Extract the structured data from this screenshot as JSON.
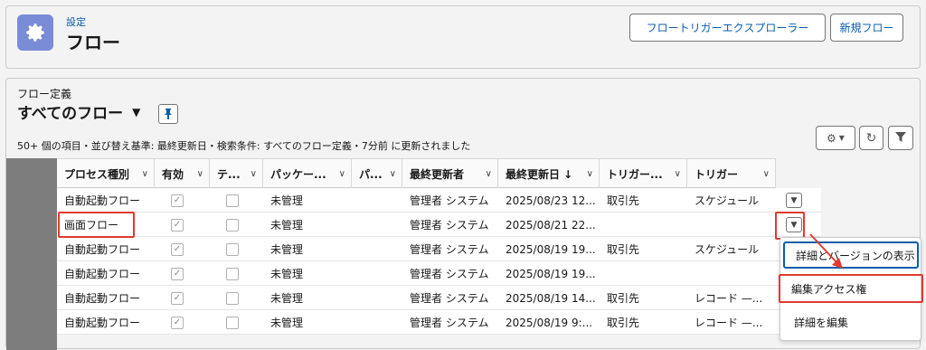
{
  "header": {
    "breadcrumb": "設定",
    "title": "フロー",
    "buttons": {
      "trigger_explorer": "フロートリガーエクスプローラー",
      "new_flow": "新規フロー"
    }
  },
  "list_view": {
    "object_label": "フロー定義",
    "view_name": "すべてのフロー",
    "status_text": "50+ 個の項目・並び替え基準: 最終更新日・検索条件: すべてのフロー定義・7分前 に更新されました"
  },
  "columns": [
    "プロセス種別",
    "有効",
    "テ...",
    "パッケー...",
    "パ...",
    "最終更新者",
    "最終更新日 ↓",
    "トリガー...",
    "トリガー"
  ],
  "rows": [
    {
      "process_type": "自動起動フロー",
      "active": true,
      "test": false,
      "package": "未管理",
      "p": "",
      "modified_by": "管理者 システム",
      "modified_date": "2025/08/23 12...",
      "trigger_object": "取引先",
      "trigger": "スケジュール"
    },
    {
      "process_type": "画面フロー",
      "active": true,
      "test": false,
      "package": "未管理",
      "p": "",
      "modified_by": "管理者 システム",
      "modified_date": "2025/08/21 22...",
      "trigger_object": "",
      "trigger": ""
    },
    {
      "process_type": "自動起動フロー",
      "active": true,
      "test": false,
      "package": "未管理",
      "p": "",
      "modified_by": "管理者 システム",
      "modified_date": "2025/08/19 19...",
      "trigger_object": "取引先",
      "trigger": "スケジュール"
    },
    {
      "process_type": "自動起動フロー",
      "active": true,
      "test": false,
      "package": "未管理",
      "p": "",
      "modified_by": "管理者 システム",
      "modified_date": "2025/08/19 19...",
      "trigger_object": "",
      "trigger": ""
    },
    {
      "process_type": "自動起動フロー",
      "active": true,
      "test": false,
      "package": "未管理",
      "p": "",
      "modified_by": "管理者 システム",
      "modified_date": "2025/08/19 14...",
      "trigger_object": "取引先",
      "trigger": "レコード —..."
    },
    {
      "process_type": "自動起動フロー",
      "active": true,
      "test": false,
      "package": "未管理",
      "p": "",
      "modified_by": "管理者 システム",
      "modified_date": "2025/08/19 9:...",
      "trigger_object": "取引先",
      "trigger": "レコード —..."
    }
  ],
  "row_menu": {
    "items": [
      "詳細とバージョンの表示",
      "編集アクセス権",
      "詳細を編集"
    ]
  },
  "colors": {
    "accent": "#0b5cab",
    "highlight": "#e03a2e",
    "app_icon": "#7a8bd8"
  },
  "icons": [
    "settings-gear-icon",
    "pin-icon",
    "gear-icon",
    "refresh-icon",
    "filter-icon",
    "chevron-down-icon",
    "checkbox-icon"
  ]
}
